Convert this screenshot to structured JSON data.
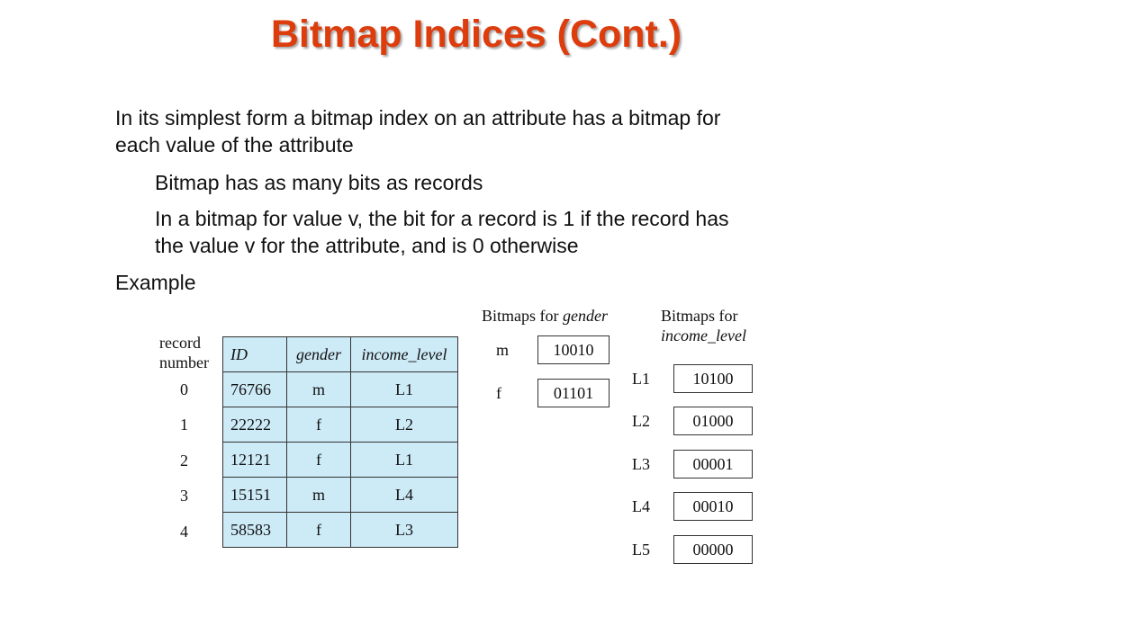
{
  "slide": {
    "title": "Bitmap Indices (Cont.)",
    "bullets": [
      {
        "text": "In its simplest form a bitmap index on an attribute has a bitmap for",
        "cont": "each value of the attribute"
      },
      {
        "text": "Bitmap has as many bits as records"
      },
      {
        "text": "In a bitmap for value v, the bit for a record is 1 if the record has",
        "cont": "the value v for the attribute, and is 0 otherwise"
      },
      {
        "text": "Example"
      }
    ]
  },
  "figure": {
    "record_number_label": [
      "record",
      "number"
    ],
    "record_numbers": [
      "0",
      "1",
      "2",
      "3",
      "4"
    ],
    "table": {
      "headers": [
        "ID",
        "gender",
        "income_level"
      ],
      "rows": [
        [
          "76766",
          "m",
          "L1"
        ],
        [
          "22222",
          "f",
          "L2"
        ],
        [
          "12121",
          "f",
          "L1"
        ],
        [
          "15151",
          "m",
          "L4"
        ],
        [
          "58583",
          "f",
          "L3"
        ]
      ]
    },
    "gender_bitmaps": {
      "title_prefix": "Bitmaps for ",
      "title_attr": "gender",
      "items": [
        {
          "value": "m",
          "bits": "10010"
        },
        {
          "value": "f",
          "bits": "01101"
        }
      ]
    },
    "income_bitmaps": {
      "title_line1": "Bitmaps for",
      "title_line2": "income_level",
      "items": [
        {
          "value": "L1",
          "bits": "10100"
        },
        {
          "value": "L2",
          "bits": "01000"
        },
        {
          "value": "L3",
          "bits": "00001"
        },
        {
          "value": "L4",
          "bits": "00010"
        },
        {
          "value": "L5",
          "bits": "00000"
        }
      ]
    }
  }
}
